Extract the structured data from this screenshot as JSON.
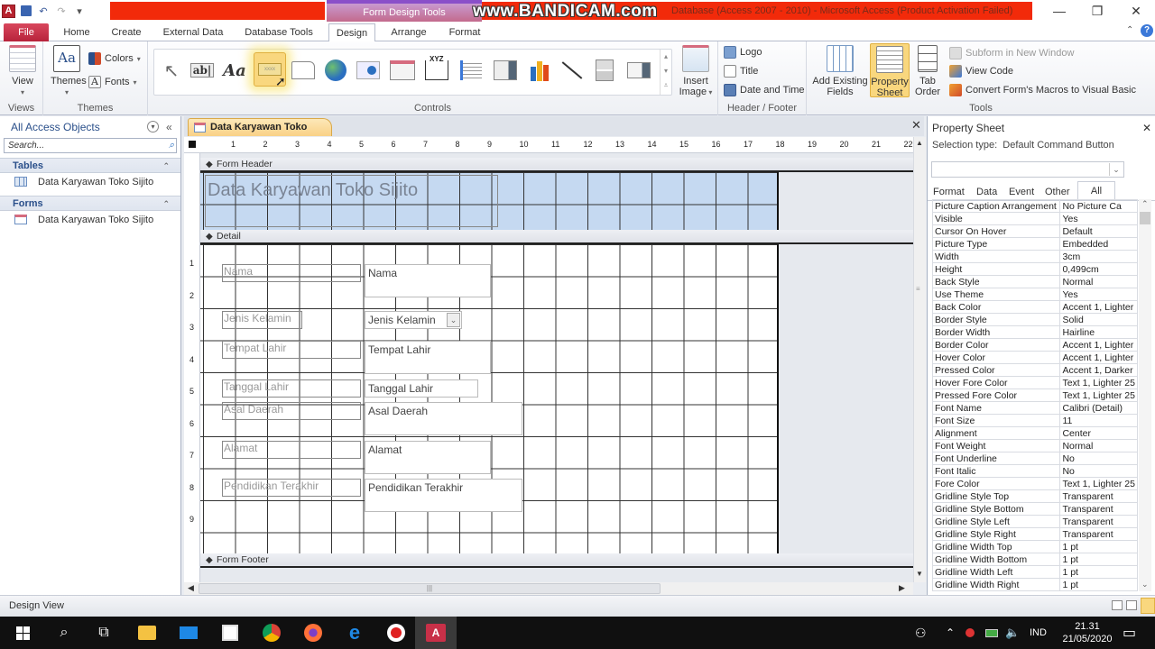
{
  "titlebar": {
    "context_tab_group": "Form Design Tools",
    "window_title": "Database (Access 2007 - 2010)  -  Microsoft Access (Product Activation Failed)",
    "watermark": "www.BANDICAM.com",
    "minimize_icon": "minimize-icon",
    "restore_icon": "restore-icon",
    "close_icon": "close-icon"
  },
  "ribbon_tabs": [
    "File",
    "Home",
    "Create",
    "External Data",
    "Database Tools",
    "Design",
    "Arrange",
    "Format"
  ],
  "active_tab": "Design",
  "ribbon": {
    "views": {
      "label": "Views",
      "view_button": "View"
    },
    "themes": {
      "label": "Themes",
      "themes_button": "Themes",
      "colors_button": "Colors",
      "fonts_button": "Fonts"
    },
    "controls": {
      "label": "Controls",
      "insert_image_line1": "Insert",
      "insert_image_line2": "Image",
      "title_xyz": "XYZ",
      "items": [
        "select-pointer",
        "text-box",
        "label",
        "button",
        "tab-control",
        "hyperlink",
        "web-browser",
        "navigation-control",
        "option-group",
        "page-break",
        "combo-box",
        "chart",
        "line",
        "toggle-button",
        "list-box"
      ]
    },
    "header_footer": {
      "label": "Header / Footer",
      "logo": "Logo",
      "title": "Title",
      "date_time": "Date and Time"
    },
    "tools": {
      "label": "Tools",
      "add_existing_line1": "Add Existing",
      "add_existing_line2": "Fields",
      "property_sheet_line1": "Property",
      "property_sheet_line2": "Sheet",
      "tab_order_line1": "Tab",
      "tab_order_line2": "Order",
      "subform": "Subform in New Window",
      "view_code": "View Code",
      "convert_macros": "Convert Form's Macros to Visual Basic"
    }
  },
  "nav_pane": {
    "title": "All Access Objects",
    "search_placeholder": "Search...",
    "groups": [
      {
        "name": "Tables",
        "items": [
          "Data Karyawan Toko Sijito"
        ]
      },
      {
        "name": "Forms",
        "items": [
          "Data Karyawan Toko Sijito"
        ]
      }
    ]
  },
  "document": {
    "tab_title": "Data Karyawan Toko Sijito",
    "ruler_h": [
      "1",
      "2",
      "3",
      "4",
      "5",
      "6",
      "7",
      "8",
      "9",
      "10",
      "11",
      "12",
      "13",
      "14",
      "15",
      "16",
      "17",
      "18",
      "19",
      "20",
      "21",
      "22"
    ],
    "ruler_v": [
      "1",
      "2",
      "3",
      "4",
      "5",
      "6",
      "7",
      "8",
      "9"
    ],
    "sections": {
      "header": "Form Header",
      "detail": "Detail",
      "footer": "Form Footer"
    },
    "form_title": "Data Karyawan Toko Sijito",
    "fields": [
      {
        "label": "Nama",
        "control": "Nama",
        "type": "textbox"
      },
      {
        "label": "Jenis Kelamin",
        "control": "Jenis Kelamin",
        "type": "combobox"
      },
      {
        "label": "Tempat Lahir",
        "control": "Tempat Lahir",
        "type": "textbox"
      },
      {
        "label": "Tanggal Lahir",
        "control": "Tanggal Lahir",
        "type": "textbox"
      },
      {
        "label": "Asal Daerah",
        "control": "Asal Daerah",
        "type": "textbox"
      },
      {
        "label": "Alamat",
        "control": "Alamat",
        "type": "textbox"
      },
      {
        "label": "Pendidikan Terakhir",
        "control": "Pendidikan Terakhir",
        "type": "textbox"
      }
    ]
  },
  "property_sheet": {
    "title": "Property Sheet",
    "selection_type_label": "Selection type:",
    "selection_type": "Default Command Button",
    "selector_value": "",
    "tabs": [
      "Format",
      "Data",
      "Event",
      "Other",
      "All"
    ],
    "active_tab": "All",
    "rows": [
      [
        "Picture Caption Arrangement",
        "No Picture Ca"
      ],
      [
        "Visible",
        "Yes"
      ],
      [
        "Cursor On Hover",
        "Default"
      ],
      [
        "Picture Type",
        "Embedded"
      ],
      [
        "Width",
        "3cm"
      ],
      [
        "Height",
        "0,499cm"
      ],
      [
        "Back Style",
        "Normal"
      ],
      [
        "Use Theme",
        "Yes"
      ],
      [
        "Back Color",
        "Accent 1, Lighter"
      ],
      [
        "Border Style",
        "Solid"
      ],
      [
        "Border Width",
        "Hairline"
      ],
      [
        "Border Color",
        "Accent 1, Lighter"
      ],
      [
        "Hover Color",
        "Accent 1, Lighter"
      ],
      [
        "Pressed Color",
        "Accent 1, Darker"
      ],
      [
        "Hover Fore Color",
        "Text 1, Lighter 25"
      ],
      [
        "Pressed Fore Color",
        "Text 1, Lighter 25"
      ],
      [
        "Font Name",
        "Calibri (Detail)"
      ],
      [
        "Font Size",
        "11"
      ],
      [
        "Alignment",
        "Center"
      ],
      [
        "Font Weight",
        "Normal"
      ],
      [
        "Font Underline",
        "No"
      ],
      [
        "Font Italic",
        "No"
      ],
      [
        "Fore Color",
        "Text 1, Lighter 25"
      ],
      [
        "Gridline Style Top",
        "Transparent"
      ],
      [
        "Gridline Style Bottom",
        "Transparent"
      ],
      [
        "Gridline Style Left",
        "Transparent"
      ],
      [
        "Gridline Style Right",
        "Transparent"
      ],
      [
        "Gridline Width Top",
        "1 pt"
      ],
      [
        "Gridline Width Bottom",
        "1 pt"
      ],
      [
        "Gridline Width Left",
        "1 pt"
      ],
      [
        "Gridline Width Right",
        "1 pt"
      ]
    ]
  },
  "statusbar": {
    "text": "Design View"
  },
  "taskbar": {
    "apps": [
      "start",
      "search",
      "task-view",
      "file-explorer",
      "mail",
      "store",
      "chrome",
      "firefox",
      "edge",
      "bandicam",
      "access"
    ],
    "language": "IND",
    "time": "21.31",
    "date": "21/05/2020"
  },
  "colors": {
    "file_tab": "#c52a45",
    "title_red": "#f22a0a",
    "header_section": "#c5d9f1",
    "highlight": "#f9d77e"
  }
}
